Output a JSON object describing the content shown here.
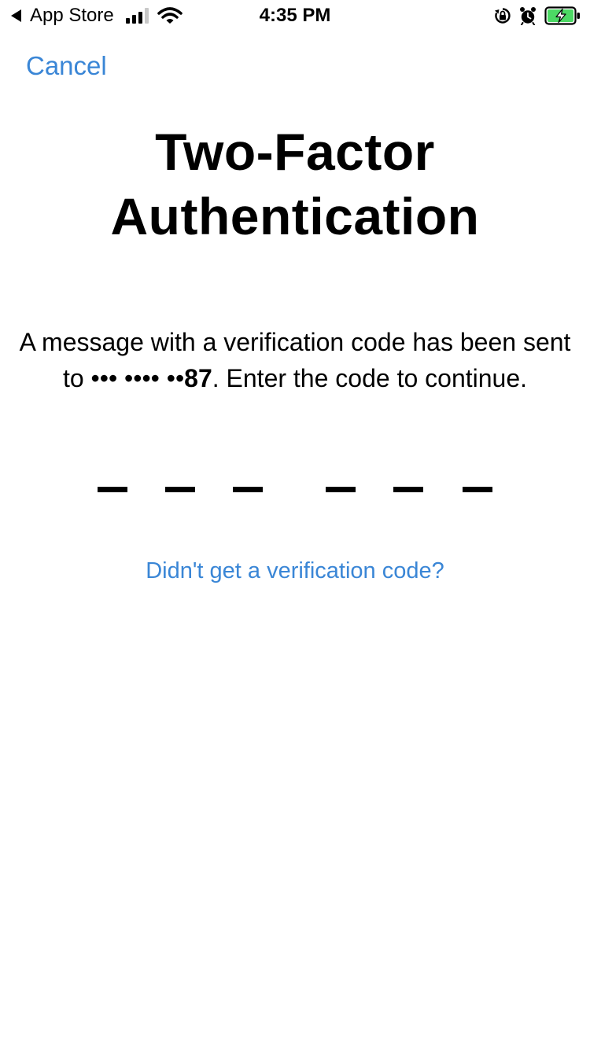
{
  "status_bar": {
    "back_app_label": "App Store",
    "time": "4:35 PM",
    "battery_color": "#4cd964",
    "icons": [
      "back-triangle-icon",
      "signal-icon",
      "wifi-icon",
      "orientation-lock-icon",
      "alarm-icon",
      "battery-charging-icon"
    ]
  },
  "nav": {
    "cancel_label": "Cancel"
  },
  "title": "Two-Factor Authentication",
  "message": {
    "before_digits": "A message with a verification code has been sent to ••• •••• ••",
    "digits": "87",
    "after_digits": ". Enter the code to continue."
  },
  "code_entry": {
    "digit_count": 6,
    "entered_value": ""
  },
  "resend_link_label": "Didn't get a verification code?",
  "colors": {
    "accent": "#3a86d6",
    "text": "#000000",
    "background": "#ffffff"
  }
}
